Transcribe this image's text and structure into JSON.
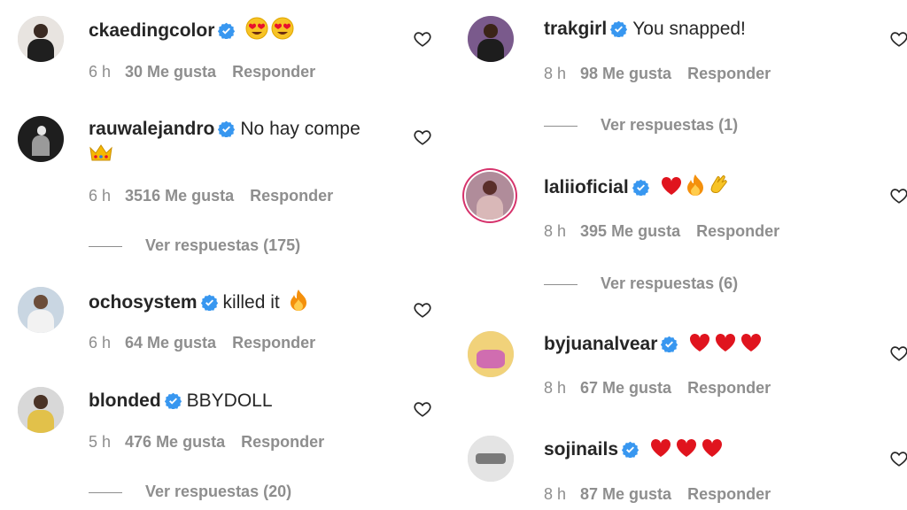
{
  "left_column": [
    {
      "username": "ckaedingcolor",
      "text": "",
      "emojis": [
        "heart-eyes-icon",
        "heart-eyes-icon"
      ],
      "time": "6 h",
      "likes": "30 Me gusta",
      "reply": "Responder",
      "view_replies": ""
    },
    {
      "username": "rauwalejandro",
      "text": "No hay compe",
      "emojis": [
        "crown-icon"
      ],
      "time": "6 h",
      "likes": "3516 Me gusta",
      "reply": "Responder",
      "view_replies": "Ver respuestas (175)"
    },
    {
      "username": "ochosystem",
      "text": "killed it",
      "emojis": [
        "fire-icon"
      ],
      "time": "6 h",
      "likes": "64 Me gusta",
      "reply": "Responder",
      "view_replies": ""
    },
    {
      "username": "blonded",
      "text": "BBYDOLL",
      "emojis": [],
      "time": "5 h",
      "likes": "476 Me gusta",
      "reply": "Responder",
      "view_replies": "Ver respuestas (20)"
    }
  ],
  "right_column": [
    {
      "username": "trakgirl",
      "text": "You snapped!",
      "emojis": [],
      "time": "8 h",
      "likes": "98 Me gusta",
      "reply": "Responder",
      "view_replies": "Ver respuestas (1)"
    },
    {
      "username": "laliioficial",
      "text": "",
      "emojis": [
        "red-heart-icon",
        "fire-icon",
        "clapping-hands-icon"
      ],
      "time": "8 h",
      "likes": "395 Me gusta",
      "reply": "Responder",
      "view_replies": "Ver respuestas (6)"
    },
    {
      "username": "byjuanalvear",
      "text": "",
      "emojis": [
        "red-heart-icon",
        "red-heart-icon",
        "red-heart-icon"
      ],
      "time": "8 h",
      "likes": "67 Me gusta",
      "reply": "Responder",
      "view_replies": ""
    },
    {
      "username": "sojinails",
      "text": "",
      "emojis": [
        "red-heart-icon",
        "red-heart-icon",
        "red-heart-icon"
      ],
      "time": "8 h",
      "likes": "87 Me gusta",
      "reply": "Responder",
      "view_replies": ""
    }
  ],
  "colors": {
    "verified": "#3897f0",
    "secondary_text": "#8e8e8e",
    "primary_text": "#262626",
    "story_ring": "#d6336c"
  }
}
